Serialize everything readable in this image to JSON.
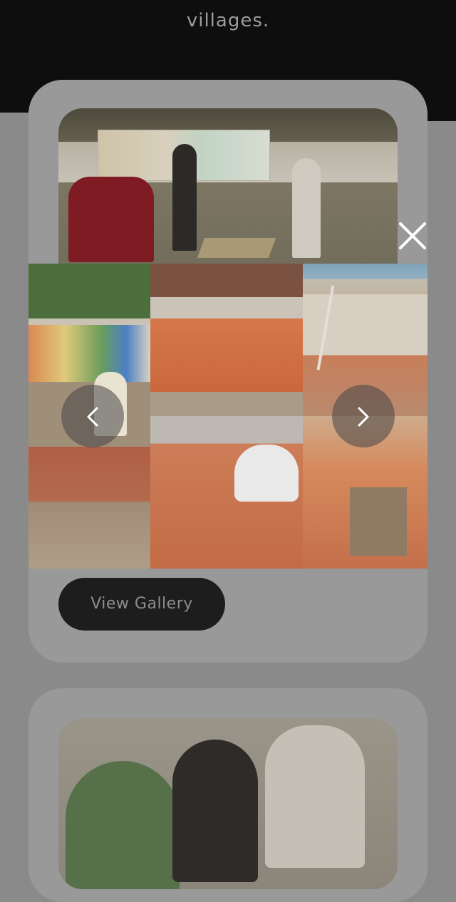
{
  "header": {
    "trailing_text": "villages."
  },
  "cards": [
    {
      "photo_alt": "People constructing a brick path near a painted wall",
      "view_gallery_label": "View Gallery"
    },
    {
      "photo_alt": "People planting in a garden"
    }
  ],
  "lightbox": {
    "close_icon": "close-icon",
    "prev_icon": "chevron-left-icon",
    "next_icon": "chevron-right-icon",
    "images": [
      "Men laying bricks beside a painted wall",
      "Finished brick patch in front of a wall",
      "Bricks laid in a yard with a man holding a pole",
      "Boy laying bricks in a courtyard",
      "Man hammering a brick path",
      "Boy placing bricks beside a hole"
    ]
  },
  "colors": {
    "backdrop": "#8a8a8a",
    "top_bar": "#0e0e0e",
    "card": "#999999",
    "button": "#1d1d1d",
    "button_text": "#8e8e8e"
  }
}
